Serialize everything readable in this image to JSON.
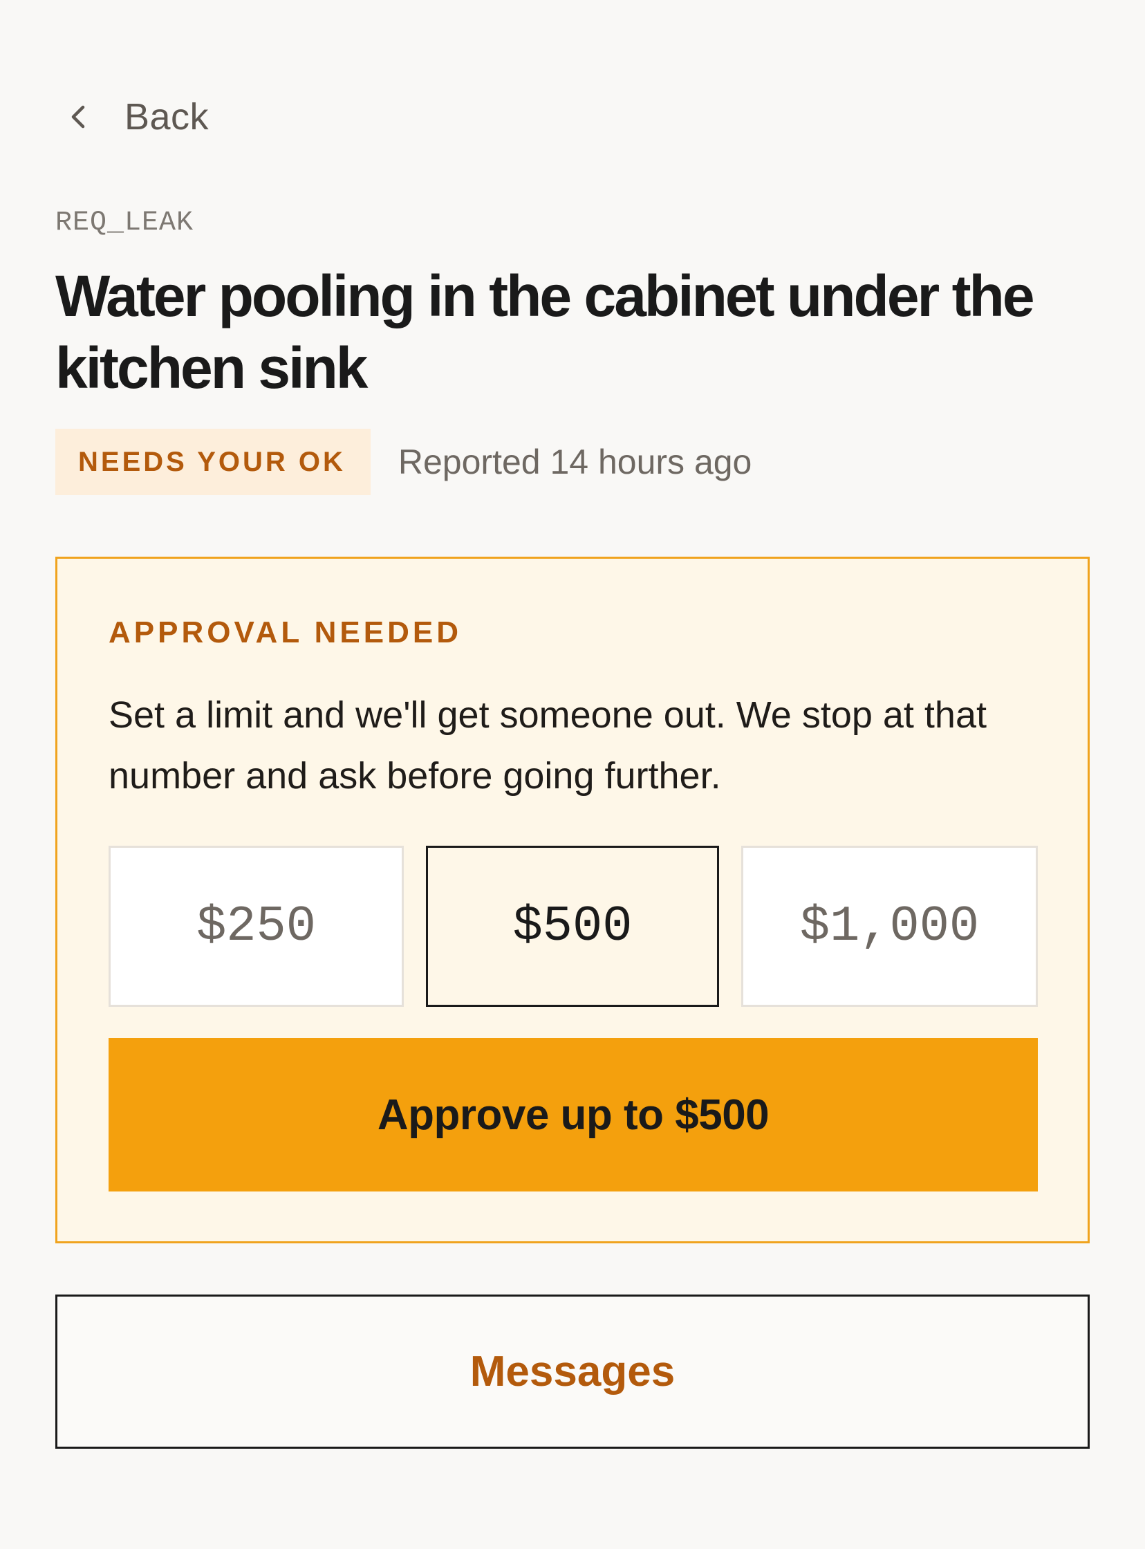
{
  "nav": {
    "back_label": "Back",
    "back_icon": "chevron-left-icon"
  },
  "request": {
    "id": "REQ_LEAK",
    "title": "Water pooling in the cabinet under the kitchen sink",
    "status_badge": "NEEDS YOUR OK",
    "reported": "Reported 14 hours ago"
  },
  "approval": {
    "eyebrow": "APPROVAL NEEDED",
    "body": "Set a limit and we'll get someone out. We stop at that number and ask before going further.",
    "options": [
      {
        "label": "$250",
        "selected": false
      },
      {
        "label": "$500",
        "selected": true
      },
      {
        "label": "$1,000",
        "selected": false
      }
    ],
    "approve_label": "Approve up to $500"
  },
  "messages": {
    "label": "Messages"
  },
  "colors": {
    "accent": "#f4a00d",
    "accent_text": "#b35a0c",
    "card_bg": "#fef7e8",
    "card_border": "#f0a31e",
    "badge_bg": "#fdeedb",
    "page_bg": "#f9f8f6"
  }
}
